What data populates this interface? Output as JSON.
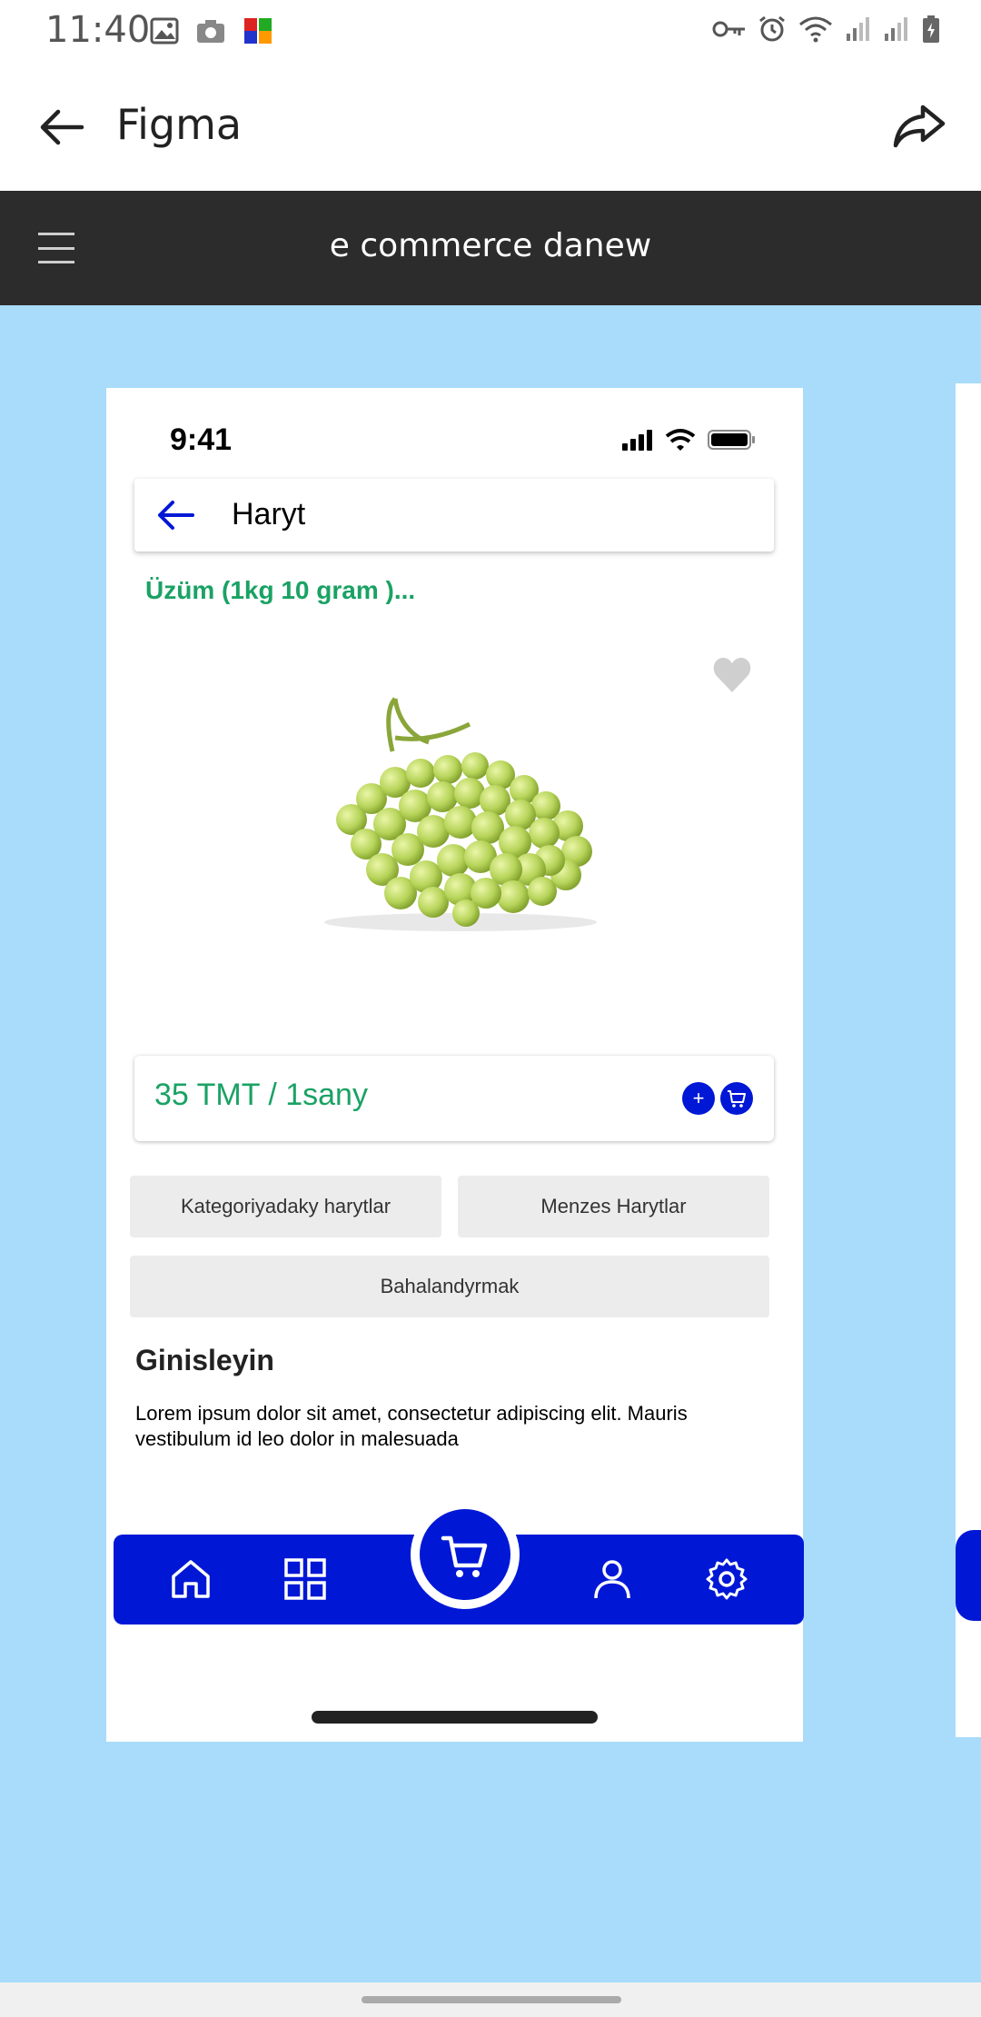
{
  "status_bar": {
    "time": "11:40"
  },
  "app_bar": {
    "title": "Figma"
  },
  "figma_header": {
    "file_name": "e commerce danew"
  },
  "frame": {
    "status_time": "9:41",
    "header_title": "Haryt",
    "product_name": "Üzüm (1kg 10 gram )...",
    "price": "35 TMT / 1sany",
    "plus_label": "+",
    "chips": [
      "Kategoriyadaky harytlar",
      "Menzes Harytlar",
      "Bahalandyrmak"
    ],
    "description_title": "Ginisleyin",
    "description_text": "Lorem ipsum dolor sit amet, consectetur adipiscing   elit. Mauris vestibulum id leo dolor in malesuada",
    "nav_items": [
      "home-icon",
      "grid-icon",
      "cart-icon",
      "user-icon",
      "settings-icon"
    ]
  },
  "colors": {
    "canvas": "#a8dcfa",
    "accent_blue": "#0018d6",
    "price_green": "#1aa264",
    "figma_dark": "#2c2c2c"
  }
}
